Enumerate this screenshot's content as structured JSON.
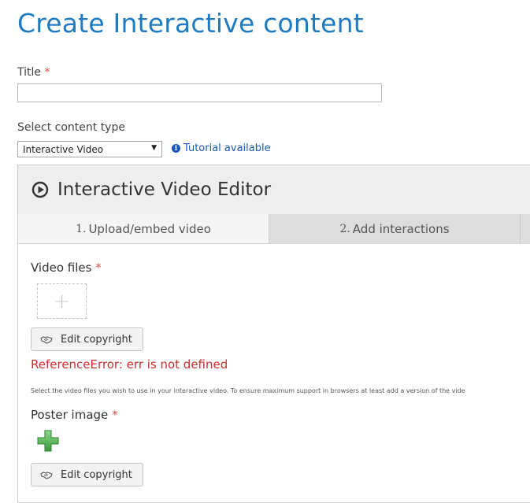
{
  "page": {
    "title": "Create Interactive content"
  },
  "form": {
    "title_label": "Title",
    "required_mark": "*",
    "title_value": "",
    "type_label": "Select content type",
    "type_selected": "Interactive Video",
    "tutorial_link": "Tutorial available"
  },
  "editor": {
    "title": "Interactive Video Editor",
    "icon": "play-circle-icon",
    "tabs": [
      {
        "number": "1.",
        "label": "Upload/embed video",
        "active": true
      },
      {
        "number": "2.",
        "label": "Add interactions",
        "active": false
      }
    ],
    "video_files_label": "Video files",
    "upload_placeholder_icon": "+",
    "edit_copyright_label": "Edit copyright",
    "error_message": "ReferenceError: err is not defined",
    "help_text": "Select the video files you wish to use in your interactive video. To ensure maximum support in browsers at least add a version of the vide",
    "poster_label": "Poster image"
  },
  "colors": {
    "title_blue": "#1f7bc1",
    "link_blue": "#1a56b8",
    "error_red": "#c9302c",
    "required_red": "#d9534f",
    "add_green": "#5cb85c"
  }
}
